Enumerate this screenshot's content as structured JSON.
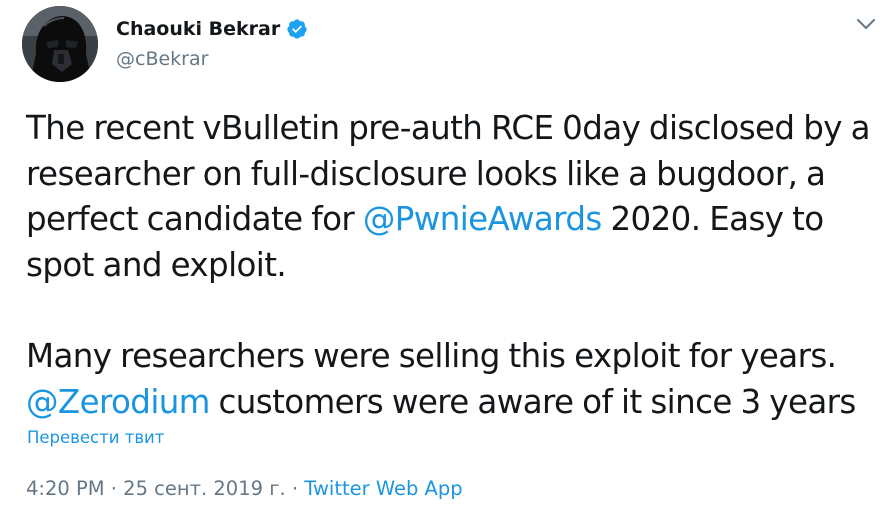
{
  "tweet": {
    "author": {
      "display_name": "Chaouki Bekrar",
      "handle": "@cBekrar",
      "verified": true
    },
    "text": {
      "p1_before": "The recent vBulletin pre-auth RCE 0day disclosed by a researcher on full-disclosure looks like a bugdoor, a perfect candidate for ",
      "p1_mention": "@PwnieAwards",
      "p1_after": " 2020. Easy to spot and exploit.",
      "p2_line": "Many researchers were selling this exploit for years.",
      "p2_mention": "@Zerodium",
      "p2_after": " customers were aware of it since 3 years"
    },
    "translate_label": "Перевести твит",
    "timestamp": "4:20 PM · 25 сент. 2019 г.",
    "separator": " · ",
    "source": "Twitter Web App"
  },
  "colors": {
    "link": "#1b95e0",
    "muted": "#657786",
    "text": "#14171a",
    "verified": "#1da1f2"
  },
  "icons": {
    "avatar": "darth-vader-avatar",
    "verified": "verified-badge-icon",
    "caret": "chevron-down-icon"
  }
}
